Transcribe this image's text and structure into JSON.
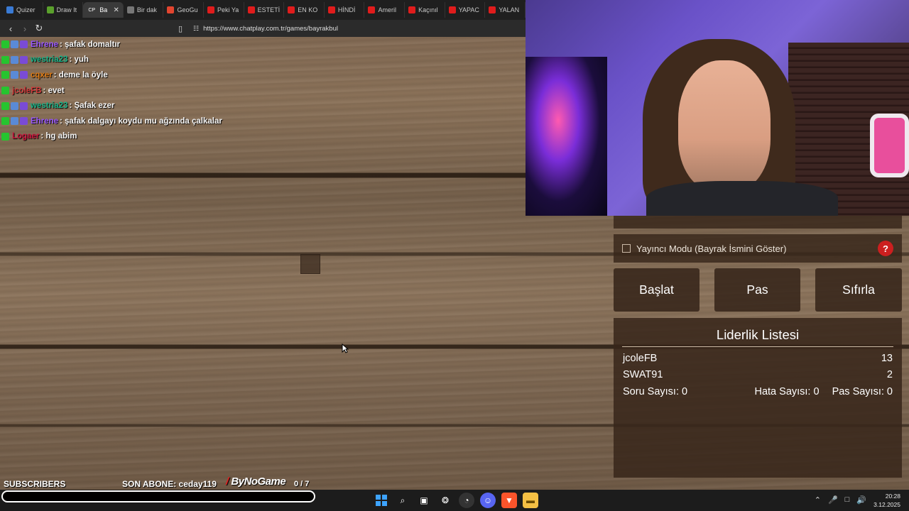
{
  "browser": {
    "tabs": [
      {
        "label": "Quizer",
        "color": "#3a7bd5",
        "icon": "quiz-favicon"
      },
      {
        "label": "Draw It",
        "color": "#5aa02c",
        "icon": "draw-favicon"
      },
      {
        "label": "Ba",
        "color": "#555555",
        "icon": "chatplay-favicon",
        "active": true
      },
      {
        "label": "Bir dak",
        "color": "#777777",
        "icon": "globe-favicon"
      },
      {
        "label": "GeoGu",
        "color": "#e2452f",
        "icon": "geoguessr-favicon"
      },
      {
        "label": "Peki Ya",
        "color": "#e01c1c",
        "icon": "youtube-favicon"
      },
      {
        "label": "ESTETİ",
        "color": "#e01c1c",
        "icon": "youtube-favicon"
      },
      {
        "label": "EN KO",
        "color": "#e01c1c",
        "icon": "youtube-favicon"
      },
      {
        "label": "HİNDİ",
        "color": "#e01c1c",
        "icon": "youtube-favicon"
      },
      {
        "label": "Ameril",
        "color": "#e01c1c",
        "icon": "youtube-favicon"
      },
      {
        "label": "Kaçınıl",
        "color": "#e01c1c",
        "icon": "youtube-favicon"
      },
      {
        "label": "YAPAC",
        "color": "#e01c1c",
        "icon": "youtube-favicon"
      },
      {
        "label": "YALAN",
        "color": "#e01c1c",
        "icon": "youtube-favicon"
      }
    ],
    "active_tab_favicon_text": "CP",
    "url": "https://www.chatplay.com.tr/games/bayrakbul"
  },
  "chat": [
    {
      "user": "Ehrene",
      "user_color": "#9b59ff",
      "message": ": şafak domaltır"
    },
    {
      "user": "westria23",
      "user_color": "#1bb58a",
      "message": ": yuh"
    },
    {
      "user": "cqxer",
      "user_color": "#e07b12",
      "message": ": deme la öyle"
    },
    {
      "user": "jcoleFB",
      "user_color": "#d23b3b",
      "message": ": evet"
    },
    {
      "user": "westria23",
      "user_color": "#1bb58a",
      "message": ": Şafak ezer"
    },
    {
      "user": "Ehrene",
      "user_color": "#9b59ff",
      "message": ": şafak dalgayı koydu mu ağzında çalkalar"
    },
    {
      "user": "Logaer",
      "user_color": "#d0153e",
      "message": ": hg abim"
    }
  ],
  "game": {
    "streamer_mode_label": "Yayıncı Modu (Bayrak İsmini Göster)",
    "help_label": "?",
    "start_label": "Başlat",
    "pass_label": "Pas",
    "reset_label": "Sıfırla",
    "leaderboard_title": "Liderlik Listesi",
    "leaderboard": [
      {
        "name": "jcoleFB",
        "score": "13"
      },
      {
        "name": "SWAT91",
        "score": "2"
      }
    ],
    "question_count_label": "Soru Sayısı: 0",
    "error_count_label": "Hata Sayısı: 0",
    "pass_count_label": "Pas Sayısı: 0"
  },
  "overlay": {
    "subscribers_label": "SUBSCRIBERS",
    "last_sub_label": "SON ABONE: ceday119",
    "brand": "ByNoGame",
    "counter": "0  / 7"
  },
  "taskbar": {
    "time": "20:28",
    "date": "3.12.2025"
  }
}
